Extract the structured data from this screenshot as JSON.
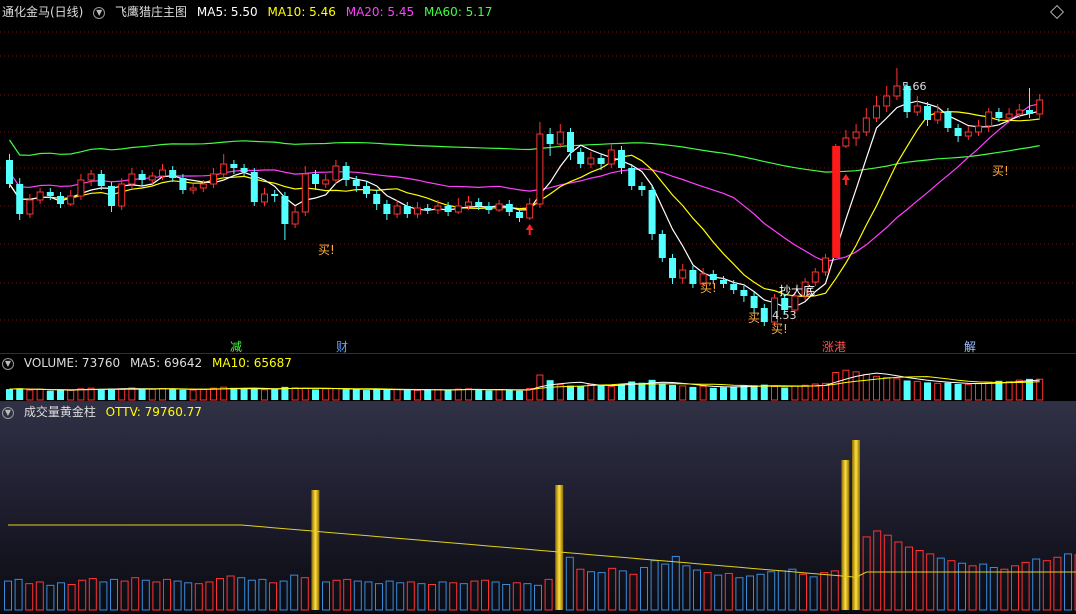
{
  "main": {
    "stock": "通化金马(日线)",
    "indicator": "飞鹰猎庄主图",
    "ma": [
      {
        "label": "MA5: 5.50",
        "color": "#ffffff"
      },
      {
        "label": "MA10: 5.46",
        "color": "#ffff00"
      },
      {
        "label": "MA20: 5.45",
        "color": "#ff40ff"
      },
      {
        "label": "MA60: 5.17",
        "color": "#40ff40"
      }
    ],
    "high_label": "5.66",
    "low_label": "4.53",
    "signals": [
      "买!",
      "买!",
      "买",
      "买!",
      "买!"
    ],
    "bottom_label": "抄大底",
    "events": [
      "减",
      "财",
      "涨港",
      "解"
    ]
  },
  "volume": {
    "label": "VOLUME: 73760",
    "ma5": "MA5: 69642",
    "ma10": "MA10: 65687"
  },
  "gold": {
    "title": "成交量黄金柱",
    "ottv": "OTTV: 79760.77"
  },
  "colors": {
    "up": "#ff3232",
    "down": "#54ffff",
    "ma5": "#ffffff",
    "ma10": "#ffff00",
    "ma20": "#ff40ff",
    "ma60": "#40ff40",
    "gold": "#ffcc00",
    "grid": "#7a1010"
  },
  "chart_data": {
    "type": "candlestick",
    "y_range": [
      4.3,
      5.9
    ],
    "candles": [
      [
        5.2,
        5.08,
        5.23,
        5.06
      ],
      [
        5.08,
        4.93,
        5.11,
        4.9
      ],
      [
        4.93,
        5.0,
        5.03,
        4.91
      ],
      [
        5.0,
        5.04,
        5.06,
        4.98
      ],
      [
        5.04,
        5.02,
        5.06,
        5.0
      ],
      [
        5.02,
        4.98,
        5.04,
        4.96
      ],
      [
        4.98,
        5.02,
        5.05,
        4.97
      ],
      [
        5.02,
        5.1,
        5.13,
        5.0
      ],
      [
        5.1,
        5.13,
        5.15,
        5.07
      ],
      [
        5.13,
        5.07,
        5.15,
        5.05
      ],
      [
        5.07,
        4.97,
        5.09,
        4.94
      ],
      [
        4.97,
        5.08,
        5.11,
        4.95
      ],
      [
        5.08,
        5.13,
        5.16,
        5.06
      ],
      [
        5.13,
        5.1,
        5.15,
        5.07
      ],
      [
        5.1,
        5.12,
        5.14,
        5.08
      ],
      [
        5.12,
        5.15,
        5.18,
        5.1
      ],
      [
        5.15,
        5.11,
        5.17,
        5.09
      ],
      [
        5.11,
        5.05,
        5.13,
        5.03
      ],
      [
        5.05,
        5.06,
        5.08,
        5.03
      ],
      [
        5.06,
        5.08,
        5.1,
        5.04
      ],
      [
        5.08,
        5.13,
        5.16,
        5.06
      ],
      [
        5.13,
        5.18,
        5.23,
        5.11
      ],
      [
        5.18,
        5.16,
        5.2,
        5.13
      ],
      [
        5.16,
        5.14,
        5.18,
        5.12
      ],
      [
        5.14,
        4.99,
        5.16,
        4.97
      ],
      [
        4.99,
        5.03,
        5.06,
        4.97
      ],
      [
        5.03,
        5.02,
        5.05,
        4.99
      ],
      [
        5.02,
        4.88,
        5.04,
        4.8
      ],
      [
        4.88,
        4.94,
        4.97,
        4.86
      ],
      [
        4.94,
        5.13,
        5.17,
        4.92
      ],
      [
        5.13,
        5.08,
        5.15,
        5.05
      ],
      [
        5.08,
        5.1,
        5.13,
        5.06
      ],
      [
        5.1,
        5.17,
        5.2,
        5.08
      ],
      [
        5.17,
        5.1,
        5.19,
        5.07
      ],
      [
        5.1,
        5.07,
        5.12,
        5.04
      ],
      [
        5.07,
        5.03,
        5.09,
        5.01
      ],
      [
        5.03,
        4.98,
        5.05,
        4.95
      ],
      [
        4.98,
        4.93,
        5.0,
        4.9
      ],
      [
        4.93,
        4.97,
        5.0,
        4.91
      ],
      [
        4.97,
        4.93,
        4.99,
        4.91
      ],
      [
        4.93,
        4.96,
        4.99,
        4.91
      ],
      [
        4.96,
        4.95,
        4.98,
        4.93
      ],
      [
        4.95,
        4.97,
        5.0,
        4.93
      ],
      [
        4.97,
        4.94,
        4.99,
        4.92
      ],
      [
        4.94,
        4.97,
        5.01,
        4.93
      ],
      [
        4.97,
        4.99,
        5.02,
        4.95
      ],
      [
        4.99,
        4.97,
        5.01,
        4.95
      ],
      [
        4.97,
        4.95,
        4.99,
        4.93
      ],
      [
        4.95,
        4.98,
        5.0,
        4.94
      ],
      [
        4.98,
        4.94,
        5.0,
        4.92
      ],
      [
        4.94,
        4.91,
        4.96,
        4.89
      ],
      [
        4.91,
        4.98,
        5.01,
        4.9
      ],
      [
        4.98,
        5.33,
        5.39,
        4.96
      ],
      [
        5.33,
        5.28,
        5.36,
        5.22
      ],
      [
        5.28,
        5.34,
        5.38,
        5.26
      ],
      [
        5.34,
        5.24,
        5.36,
        5.2
      ],
      [
        5.24,
        5.18,
        5.26,
        5.16
      ],
      [
        5.18,
        5.21,
        5.24,
        5.16
      ],
      [
        5.21,
        5.18,
        5.23,
        5.15
      ],
      [
        5.18,
        5.25,
        5.28,
        5.16
      ],
      [
        5.25,
        5.16,
        5.27,
        5.13
      ],
      [
        5.16,
        5.07,
        5.18,
        5.05
      ],
      [
        5.07,
        5.05,
        5.09,
        5.02
      ],
      [
        5.05,
        4.83,
        5.07,
        4.8
      ],
      [
        4.83,
        4.71,
        4.85,
        4.69
      ],
      [
        4.71,
        4.61,
        4.73,
        4.58
      ],
      [
        4.61,
        4.65,
        4.68,
        4.58
      ],
      [
        4.65,
        4.58,
        4.67,
        4.56
      ],
      [
        4.58,
        4.63,
        4.66,
        4.57
      ],
      [
        4.63,
        4.6,
        4.65,
        4.58
      ],
      [
        4.6,
        4.58,
        4.62,
        4.56
      ],
      [
        4.58,
        4.55,
        4.6,
        4.53
      ],
      [
        4.55,
        4.52,
        4.57,
        4.49
      ],
      [
        4.52,
        4.46,
        4.54,
        4.43
      ],
      [
        4.46,
        4.39,
        4.48,
        4.37
      ],
      [
        4.39,
        4.51,
        4.53,
        4.37
      ],
      [
        4.51,
        4.45,
        4.53,
        4.43
      ],
      [
        4.45,
        4.52,
        4.54,
        4.44
      ],
      [
        4.52,
        4.59,
        4.61,
        4.5
      ],
      [
        4.59,
        4.64,
        4.66,
        4.57
      ],
      [
        4.64,
        4.71,
        4.73,
        4.62
      ],
      [
        4.71,
        5.27,
        5.28,
        4.71
      ],
      [
        5.27,
        5.31,
        5.35,
        5.26
      ],
      [
        5.31,
        5.34,
        5.38,
        5.27
      ],
      [
        5.34,
        5.41,
        5.46,
        5.32
      ],
      [
        5.41,
        5.47,
        5.52,
        5.39
      ],
      [
        5.47,
        5.52,
        5.57,
        5.44
      ],
      [
        5.52,
        5.57,
        5.66,
        5.5
      ],
      [
        5.57,
        5.44,
        5.59,
        5.41
      ],
      [
        5.44,
        5.47,
        5.52,
        5.42
      ],
      [
        5.47,
        5.4,
        5.49,
        5.37
      ],
      [
        5.4,
        5.44,
        5.48,
        5.38
      ],
      [
        5.44,
        5.36,
        5.46,
        5.34
      ],
      [
        5.36,
        5.32,
        5.38,
        5.29
      ],
      [
        5.32,
        5.34,
        5.37,
        5.3
      ],
      [
        5.34,
        5.37,
        5.4,
        5.32
      ],
      [
        5.37,
        5.44,
        5.46,
        5.34
      ],
      [
        5.44,
        5.41,
        5.46,
        5.39
      ],
      [
        5.41,
        5.43,
        5.46,
        5.39
      ],
      [
        5.43,
        5.45,
        5.48,
        5.41
      ],
      [
        5.45,
        5.43,
        5.56,
        5.41
      ],
      [
        5.43,
        5.5,
        5.53,
        5.41
      ]
    ],
    "volume": [
      34,
      36,
      31,
      33,
      29,
      32,
      30,
      35,
      37,
      33,
      36,
      34,
      38,
      35,
      33,
      36,
      34,
      32,
      31,
      33,
      37,
      40,
      38,
      35,
      36,
      32,
      34,
      41,
      38,
      37,
      33,
      35,
      36,
      34,
      33,
      31,
      34,
      32,
      33,
      31,
      30,
      33,
      32,
      31,
      34,
      35,
      33,
      30,
      32,
      31,
      29,
      36,
      78,
      62,
      48,
      45,
      44,
      49,
      46,
      42,
      50,
      58,
      54,
      63,
      52,
      47,
      44,
      41,
      43,
      38,
      40,
      42,
      45,
      46,
      48,
      42,
      39,
      44,
      46,
      50,
      52,
      86,
      93,
      88,
      80,
      74,
      70,
      66,
      61,
      58,
      55,
      52,
      54,
      50,
      48,
      52,
      56,
      60,
      58,
      62,
      66,
      65
    ],
    "gold_bars": [
      29,
      52,
      79,
      80
    ],
    "gold_tall": [
      120,
      125,
      150,
      170
    ]
  }
}
